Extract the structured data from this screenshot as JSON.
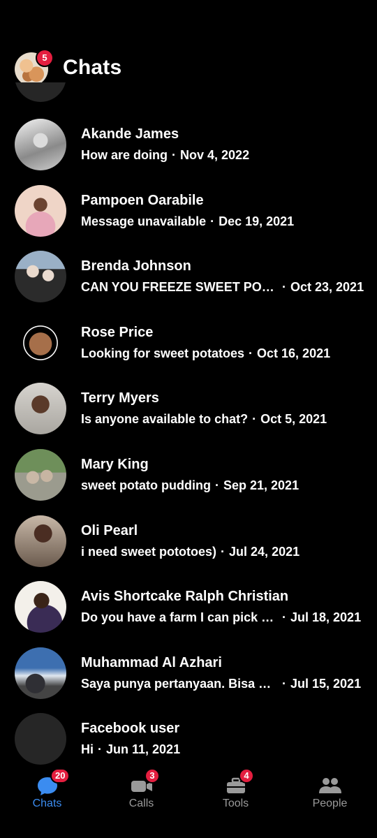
{
  "header": {
    "title": "Chats",
    "profile_badge": "5"
  },
  "chats": [
    {
      "name": "Akande James",
      "preview": "How are doing",
      "date": "Nov 4, 2022"
    },
    {
      "name": "Pampoen Oarabile",
      "preview": "Message unavailable",
      "date": "Dec 19, 2021"
    },
    {
      "name": "Brenda Johnson",
      "preview": "CAN YOU FREEZE SWEET POTA...",
      "date": "Oct 23, 2021"
    },
    {
      "name": "Rose Price",
      "preview": "Looking for sweet potatoes",
      "date": "Oct 16, 2021"
    },
    {
      "name": "Terry Myers",
      "preview": "Is anyone available to chat?",
      "date": "Oct 5, 2021"
    },
    {
      "name": "Mary King",
      "preview": "sweet potato pudding",
      "date": "Sep 21, 2021"
    },
    {
      "name": "Oli Pearl",
      "preview": "i need sweet pototoes)",
      "date": "Jul 24, 2021"
    },
    {
      "name": "Avis Shortcake Ralph Christian",
      "preview": "Do you have a farm I can pick po...",
      "date": "Jul 18, 2021"
    },
    {
      "name": "Muhammad Al Azhari",
      "preview": "Saya punya pertanyaan. Bisa ba...",
      "date": "Jul 15, 2021"
    },
    {
      "name": "Facebook user",
      "preview": "Hi",
      "date": "Jun 11, 2021"
    }
  ],
  "separator": "·",
  "nav": {
    "chats": {
      "label": "Chats",
      "badge": "20",
      "icon": "chat-bubble-icon"
    },
    "calls": {
      "label": "Calls",
      "badge": "3",
      "icon": "video-camera-icon"
    },
    "tools": {
      "label": "Tools",
      "badge": "4",
      "icon": "toolbox-icon"
    },
    "people": {
      "label": "People",
      "icon": "people-icon"
    }
  },
  "colors": {
    "accent": "#3b8cf0",
    "badge": "#e41e3f",
    "inactive": "#9a9a9a",
    "background": "#000000"
  }
}
